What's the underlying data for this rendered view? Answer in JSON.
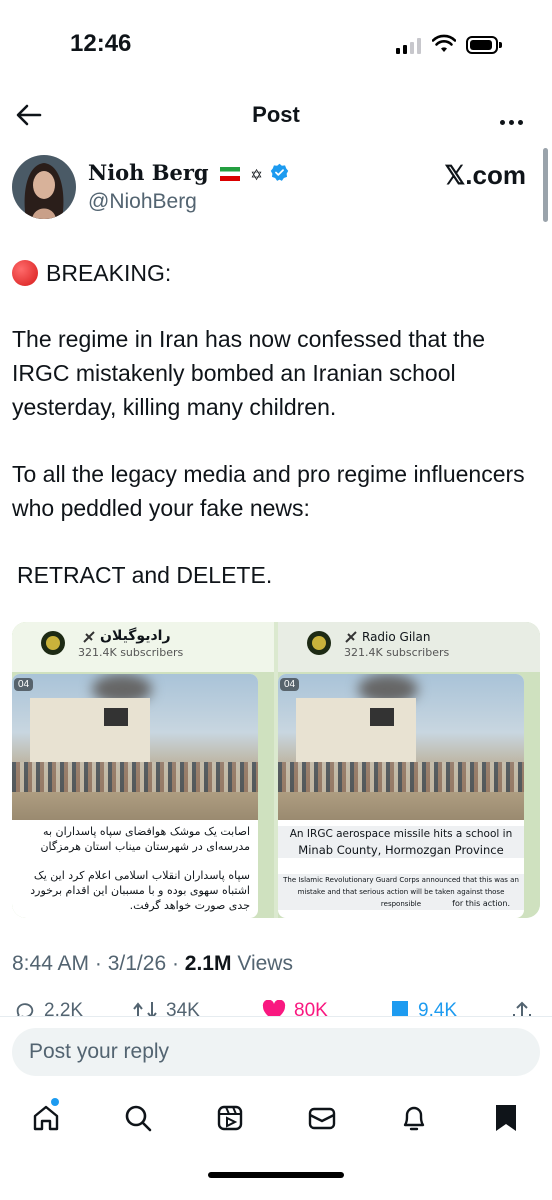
{
  "status_bar": {
    "time": "12:46"
  },
  "header": {
    "title": "Post"
  },
  "author": {
    "name": "Nioh Berg",
    "handle": "@NiohBerg",
    "badges": [
      "🇮🇷",
      "✡"
    ]
  },
  "source_badge": "𝕏.com",
  "post": {
    "breaking": "BREAKING:",
    "paragraph1": "The regime in Iran has now confessed that the IRGC mistakenly bombed an Iranian school yesterday, killing many children.",
    "paragraph2": "To all the legacy media and pro regime influencers who peddled your fake news:",
    "paragraph3": "RETRACT and DELETE."
  },
  "media": {
    "left": {
      "channel": "راديوگیلان",
      "subscribers": "321.4K subscribers",
      "video_badge": "04",
      "headline": "اصابت یک موشک هوافضای سپاه پاسداران به مدرسه‌ای در شهرستان میناب استان هرمزگان",
      "body": "سپاه پاسداران انقلاب اسلامی اعلام کرد این یک اشتباه سهوی بوده و با مسببان این اقدام برخورد جدی صورت خواهد گرفت."
    },
    "right": {
      "channel": "Radio Gilan",
      "subscribers": "321.4K subscribers",
      "video_badge": "04",
      "headline_line1": "An IRGC aerospace missile hits a school in",
      "headline_line2": "Minab County, Hormozgan Province",
      "body_line1": "The Islamic Revolutionary Guard Corps announced that this was an inadvertent",
      "body_line2": "mistake and that serious action will be taken against those responsible",
      "body_line3": "for this action."
    }
  },
  "meta": {
    "time": "8:44 AM",
    "date": "3/1/26",
    "views": "2.1M",
    "views_label": "Views"
  },
  "actions": {
    "replies": "2.2K",
    "reposts": "34K",
    "likes": "80K",
    "bookmarks": "9.4K"
  },
  "reply_placeholder": "Post your reply",
  "tabs": [
    "home",
    "search",
    "grok",
    "messages",
    "notifications",
    "bookmarks"
  ],
  "colors": {
    "accent": "#1d9bf0",
    "like": "#f91880",
    "text": "#0f1419",
    "secondary": "#536471"
  }
}
